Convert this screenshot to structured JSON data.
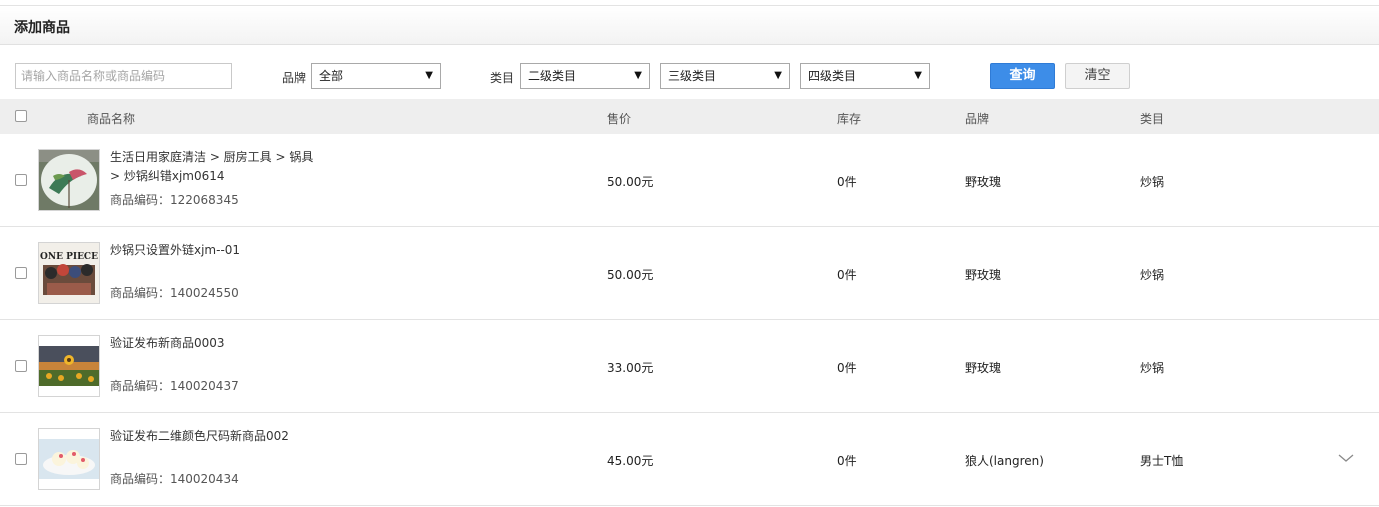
{
  "header": {
    "title": "添加商品"
  },
  "filters": {
    "search_placeholder": "请输入商品名称或商品编码",
    "brand_label": "品牌",
    "brand_value": "全部",
    "category_label": "类目",
    "cat2_value": "二级类目",
    "cat3_value": "三级类目",
    "cat4_value": "四级类目",
    "query_label": "查询",
    "clear_label": "清空"
  },
  "table": {
    "columns": {
      "name": "商品名称",
      "price": "售价",
      "stock": "库存",
      "brand": "品牌",
      "category": "类目"
    },
    "rows": [
      {
        "name_line1": "生活日用家庭清洁 > 厨房工具 > 锅具",
        "name_line2": "> 炒锅纠错xjm0614",
        "code": "商品编码：122068345",
        "price": "50.00元",
        "stock": "0件",
        "brand": "野玫瑰",
        "category": "炒锅"
      },
      {
        "name_line1": "炒锅只设置外链xjm--01",
        "name_line2": "",
        "code": "商品编码：140024550",
        "price": "50.00元",
        "stock": "0件",
        "brand": "野玫瑰",
        "category": "炒锅",
        "thumb_text": "ONE PIECE"
      },
      {
        "name_line1": "验证发布新商品0003",
        "name_line2": "",
        "code": "商品编码：140020437",
        "price": "33.00元",
        "stock": "0件",
        "brand": "野玫瑰",
        "category": "炒锅"
      },
      {
        "name_line1": "验证发布二维颜色尺码新商品002",
        "name_line2": "",
        "code": "商品编码：140020434",
        "price": "45.00元",
        "stock": "0件",
        "brand": "狼人(langren)",
        "category": "男士T恤"
      }
    ]
  },
  "icons": {
    "expand": "chevron-down-icon",
    "dropdown": "triangle-down-icon"
  },
  "colors": {
    "primary_button": "#3d8de8",
    "header_bg": "#eeeeee"
  }
}
